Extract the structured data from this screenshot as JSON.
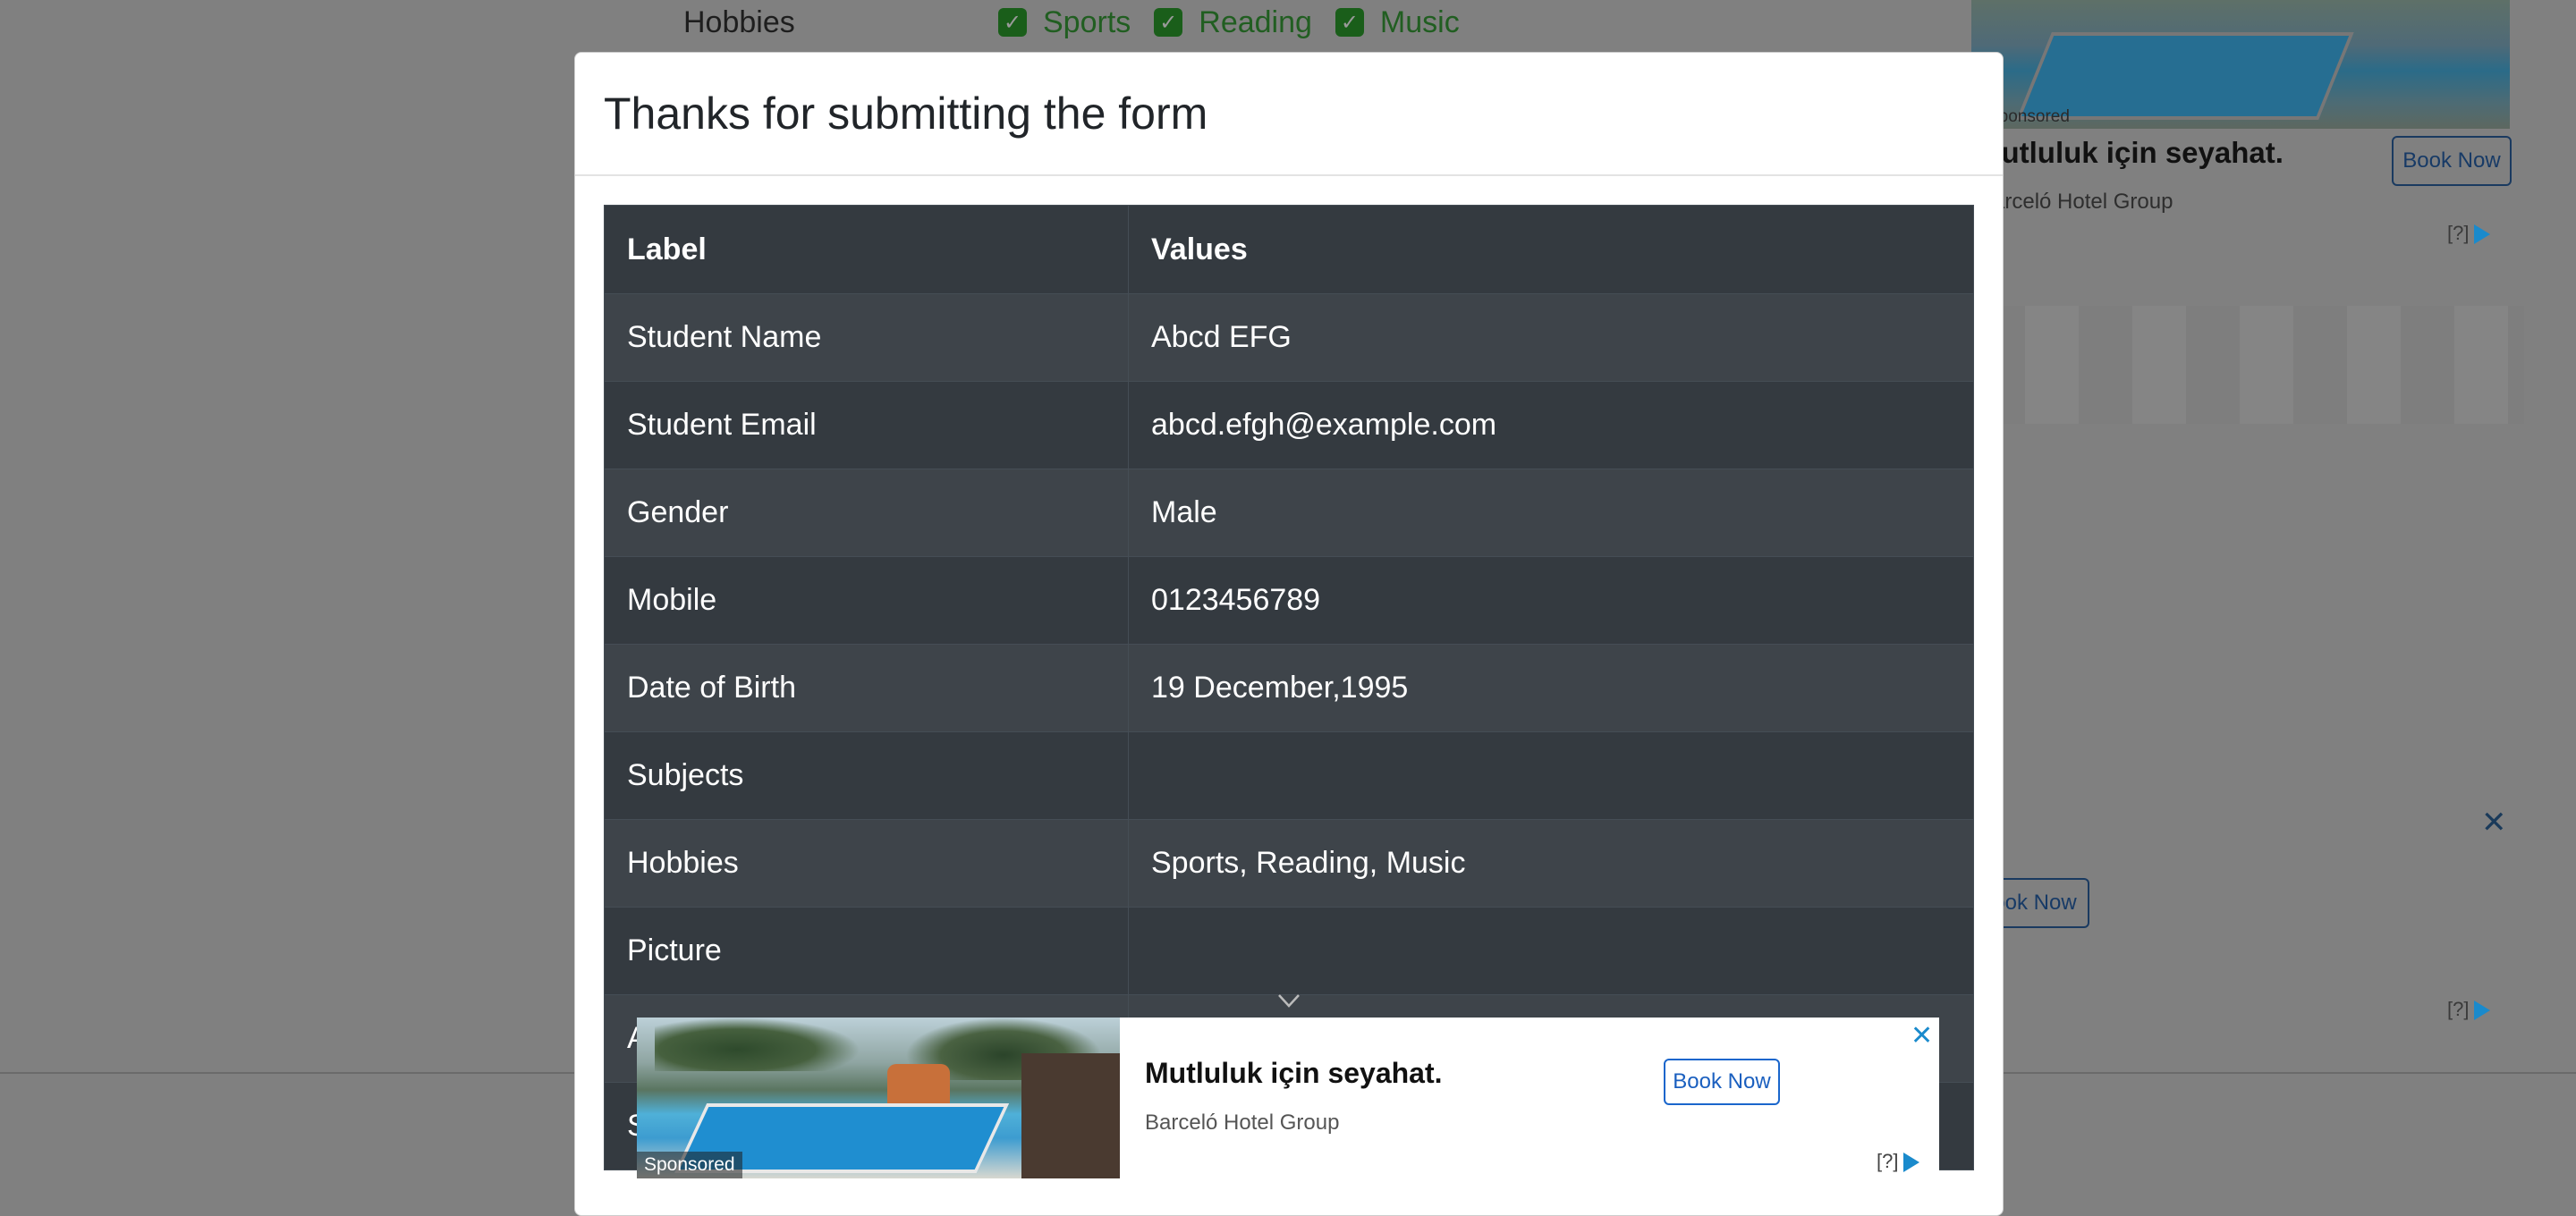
{
  "background": {
    "hobbies_label": "Hobbies",
    "hobby_options": [
      "Sports",
      "Reading",
      "Music"
    ],
    "ad_sponsored": "Sponsored",
    "ad_title": "Mutluluk için seyahat.",
    "ad_brand": "Barceló Hotel Group",
    "ad_button": "Book Now",
    "ad_info": "[?]",
    "ad_close": "✕"
  },
  "modal": {
    "title": "Thanks for submitting the form",
    "table": {
      "headers": [
        "Label",
        "Values"
      ],
      "rows": [
        [
          "Student Name",
          "Abcd EFG"
        ],
        [
          "Student Email",
          "abcd.efgh@example.com"
        ],
        [
          "Gender",
          "Male"
        ],
        [
          "Mobile",
          "0123456789"
        ],
        [
          "Date of Birth",
          "19 December,1995"
        ],
        [
          "Subjects",
          ""
        ],
        [
          "Hobbies",
          "Sports, Reading, Music"
        ],
        [
          "Picture",
          ""
        ],
        [
          "A",
          ""
        ],
        [
          "S",
          ""
        ]
      ]
    }
  },
  "bottom_ad": {
    "sponsored": "Sponsored",
    "title": "Mutluluk için seyahat.",
    "brand": "Barceló Hotel Group",
    "button": "Book Now",
    "info": "[?]",
    "close": "✕"
  },
  "colors": {
    "overlay": "#808080",
    "table_dark": "#343a40",
    "table_stripe": "#3e444a",
    "checkbox_green": "#1a5e1a",
    "ad_button_blue": "#1a66cc"
  }
}
